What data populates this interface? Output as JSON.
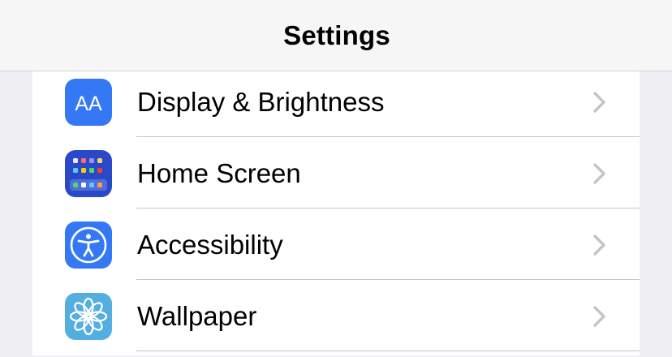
{
  "nav": {
    "title": "Settings"
  },
  "rows": [
    {
      "label": "Display & Brightness",
      "icon": "display-brightness-icon",
      "icon_color": "#3478f6",
      "icon_text": "AA"
    },
    {
      "label": "Home Screen",
      "icon": "home-screen-icon",
      "icon_color": "#2a49c8"
    },
    {
      "label": "Accessibility",
      "icon": "accessibility-icon",
      "icon_color": "#3478f6"
    },
    {
      "label": "Wallpaper",
      "icon": "wallpaper-icon",
      "icon_color": "#55aee0"
    }
  ],
  "colors": {
    "background": "#efeff4",
    "navbar": "#f6f6f6",
    "separator": "#c6c6c8",
    "chevron": "#c4c4c7"
  }
}
